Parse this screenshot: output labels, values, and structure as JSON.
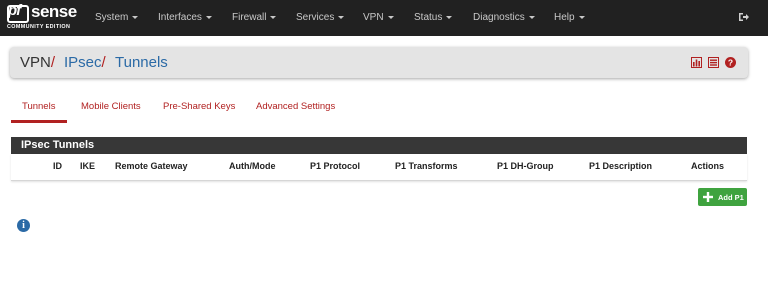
{
  "navbar": {
    "logo": {
      "brand_pf": "pf",
      "brand_sense": "sense",
      "edition": "COMMUNITY EDITION"
    },
    "menu": [
      {
        "label": "System"
      },
      {
        "label": "Interfaces"
      },
      {
        "label": "Firewall"
      },
      {
        "label": "Services"
      },
      {
        "label": "VPN"
      },
      {
        "label": "Status"
      },
      {
        "label": "Diagnostics"
      },
      {
        "label": "Help"
      }
    ],
    "logout_icon": "sign-out-icon"
  },
  "breadcrumb": {
    "items": [
      "VPN",
      "IPsec",
      "Tunnels"
    ],
    "separator": "/",
    "icons": [
      "bar-chart-icon",
      "list-icon",
      "help-icon"
    ]
  },
  "tabs": [
    {
      "label": "Tunnels",
      "active": true
    },
    {
      "label": "Mobile Clients",
      "active": false
    },
    {
      "label": "Pre-Shared Keys",
      "active": false
    },
    {
      "label": "Advanced Settings",
      "active": false
    }
  ],
  "table": {
    "title": "IPsec Tunnels",
    "columns": [
      "ID",
      "IKE",
      "Remote Gateway",
      "Auth/Mode",
      "P1 Protocol",
      "P1 Transforms",
      "P1 DH-Group",
      "P1 Description",
      "Actions"
    ]
  },
  "add_button": {
    "label": "Add P1",
    "icon": "plus-icon"
  },
  "info_icon": {
    "glyph": "i"
  },
  "colors": {
    "navbar": "#212121",
    "accent_red": "#b12121",
    "link_blue": "#2b6aa6",
    "success_green": "#3fa33f",
    "table_header": "#373737"
  }
}
